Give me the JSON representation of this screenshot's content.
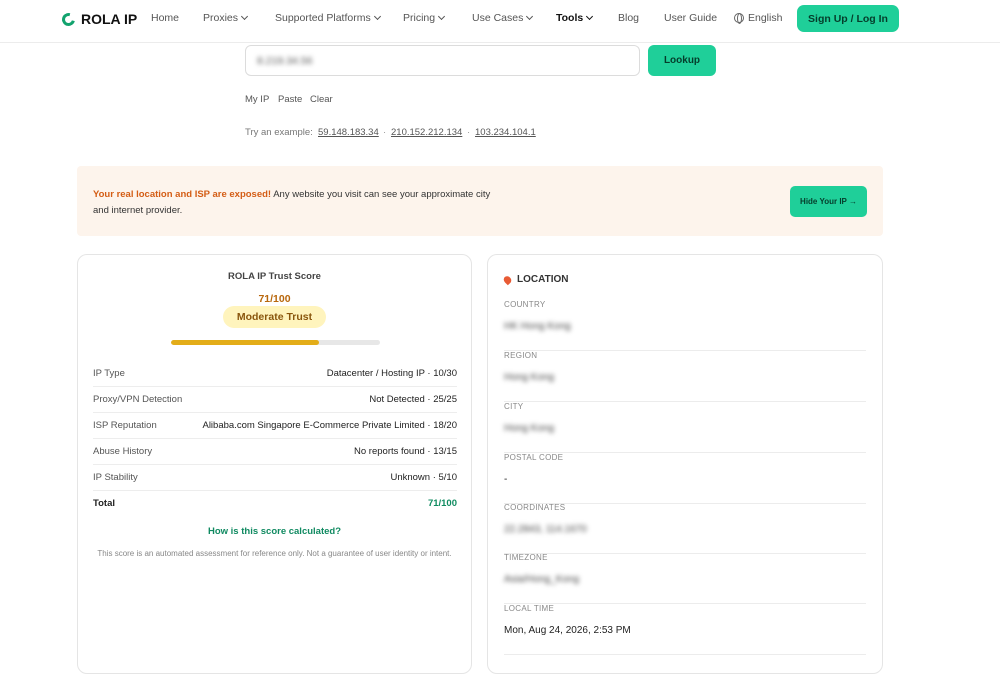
{
  "nav": {
    "brand": "ROLA IP",
    "items": [
      "Home",
      "Proxies",
      "Supported Platforms",
      "Pricing",
      "Use Cases",
      "Tools",
      "Blog",
      "User Guide"
    ],
    "language": "English",
    "signup": "Sign Up / Log In",
    "accent": "#1fcf99"
  },
  "lookup": {
    "ip_value": "8.219.34.56",
    "button": "Lookup",
    "quick_actions": [
      "My IP",
      "Paste",
      "Clear"
    ],
    "example_label": "Try an example:",
    "examples": [
      "59.148.183.34",
      "210.152.212.134",
      "103.234.104.1"
    ]
  },
  "alert": {
    "strong": "Your real location and ISP are exposed!",
    "text": " Any website you visit can see your approximate city and internet provider.",
    "button": "Hide Your IP →",
    "background": "#fdf4ec"
  },
  "score": {
    "title": "ROLA IP Trust Score",
    "value": "71/100",
    "badge": "Moderate Trust",
    "progress": 0.71,
    "rows": [
      {
        "label": "IP Type",
        "value": "Datacenter / Hosting IP · 10/30"
      },
      {
        "label": "Proxy/VPN Detection",
        "value": "Not Detected · 25/25"
      },
      {
        "label": "ISP Reputation",
        "value": "Alibaba.com Singapore E-Commerce Private Limited · 18/20"
      },
      {
        "label": "Abuse History",
        "value": "No reports found · 13/15"
      },
      {
        "label": "IP Stability",
        "value": "Unknown · 5/10"
      }
    ],
    "total": {
      "label": "Total",
      "value": "71/100"
    },
    "how_link": "How is this score calculated?",
    "disclaimer": "This score is an automated assessment for reference only. Not a guarantee of user identity or intent."
  },
  "location": {
    "title": "LOCATION",
    "fields": [
      {
        "label": "COUNTRY",
        "value": "HK Hong Kong"
      },
      {
        "label": "REGION",
        "value": "Hong Kong"
      },
      {
        "label": "CITY",
        "value": "Hong Kong"
      },
      {
        "label": "POSTAL CODE",
        "value": "-"
      },
      {
        "label": "COORDINATES",
        "value": "22.2843, 114.1670"
      },
      {
        "label": "TIMEZONE",
        "value": "Asia/Hong_Kong"
      },
      {
        "label": "LOCAL TIME",
        "value": "Mon, Aug 24, 2026, 2:53 PM"
      }
    ]
  }
}
